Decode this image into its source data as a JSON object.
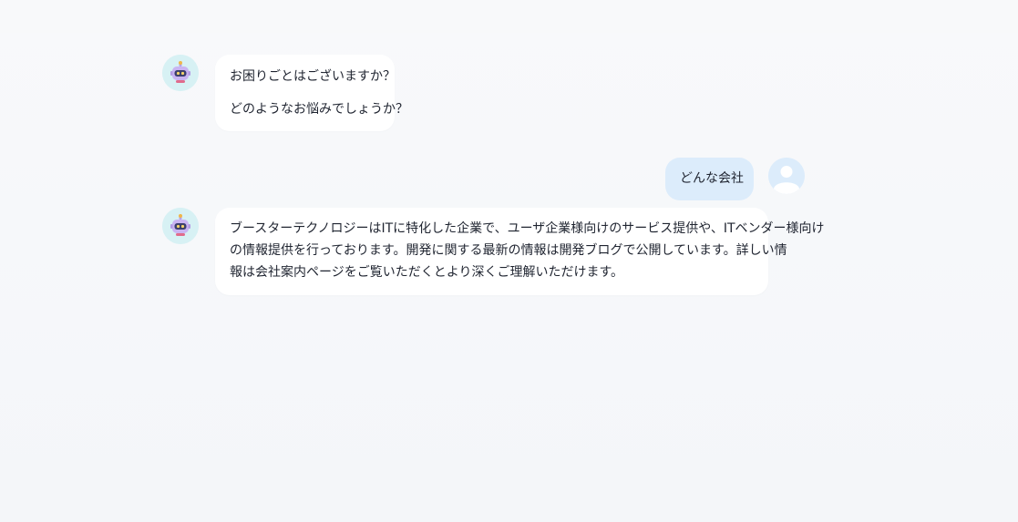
{
  "messages": [
    {
      "role": "bot",
      "avatar_icon": "robot-icon",
      "paragraphs": [
        "お困りごとはございますか？",
        "どのようなお悩みでしょうか？"
      ]
    },
    {
      "role": "user",
      "avatar_icon": "user-icon",
      "paragraphs": [
        "どんな会社"
      ]
    },
    {
      "role": "bot",
      "avatar_icon": "robot-icon",
      "lines": [
        "ブースターテクノロジーはITに特化した企業で、ユーザ企業様向けのサービス提供や、ITベンダー様向け",
        "の情報提供を行っております。開発に関する最新の情報は開発ブログで公開しています。詳しい情",
        "報は会社案内ページをご覧いただくとより深くご理解いただけます。"
      ]
    }
  ],
  "colors": {
    "bot_bubble": "#ffffff",
    "user_bubble": "#dcecfb",
    "bot_avatar_bg": "#d7f1f4",
    "user_avatar_bg": "#dcecfb",
    "page_bg": "#f6f7f9"
  }
}
